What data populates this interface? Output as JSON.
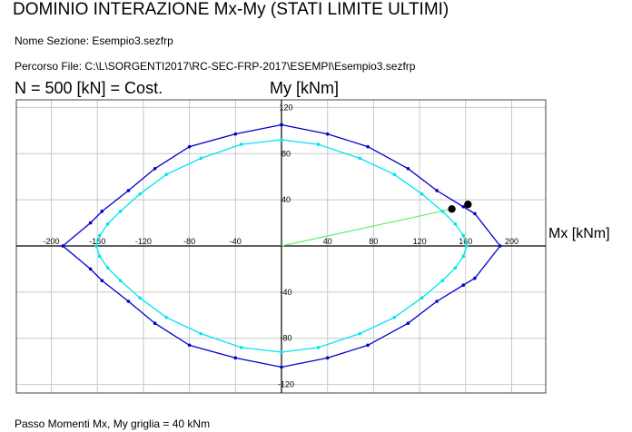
{
  "header": {
    "title": "DOMINIO INTERAZIONE Mx-My (STATI LIMITE ULTIMI)",
    "nome_sezione": "Nome Sezione:  Esempio3.sezfrp",
    "percorso_file": "Percorso File: C:\\L\\SORGENTI2017\\RC-SEC-FRP-2017\\ESEMPI\\Esempio3.sezfrp",
    "n_label": "N = 500 [kN] = Cost."
  },
  "footer": {
    "passo": "Passo Momenti Mx, My  griglia  = 40 kNm"
  },
  "chart_data": {
    "type": "line",
    "xlabel": "Mx [kNm]",
    "ylabel": "My  [kNm]",
    "xlim": [
      -230,
      230
    ],
    "ylim": [
      -127,
      127
    ],
    "grid": true,
    "x_tick_labels": [
      "-200",
      "-160",
      "-120",
      "-80",
      "-40",
      "40",
      "80",
      "120",
      "160",
      "200"
    ],
    "y_tick_labels": [
      "120",
      "80",
      "40",
      "-40",
      "-80",
      "-120"
    ],
    "series": [
      {
        "color": "#0000cc",
        "marker_color": "#0000cc",
        "points": [
          [
            0,
            105
          ],
          [
            40,
            97
          ],
          [
            75,
            86
          ],
          [
            110,
            67
          ],
          [
            135,
            48
          ],
          [
            158,
            34
          ],
          [
            168,
            28
          ],
          [
            190,
            0
          ],
          [
            168,
            -28
          ],
          [
            158,
            -34
          ],
          [
            135,
            -48
          ],
          [
            110,
            -67
          ],
          [
            75,
            -86
          ],
          [
            40,
            -97
          ],
          [
            0,
            -105
          ],
          [
            -40,
            -97
          ],
          [
            -80,
            -86
          ],
          [
            -110,
            -67
          ],
          [
            -133,
            -48
          ],
          [
            -156,
            -30
          ],
          [
            -166,
            -20
          ],
          [
            -190,
            0
          ],
          [
            -166,
            20
          ],
          [
            -156,
            30
          ],
          [
            -133,
            48
          ],
          [
            -110,
            67
          ],
          [
            -80,
            86
          ],
          [
            -40,
            97
          ],
          [
            0,
            105
          ]
        ]
      },
      {
        "color": "#00e5ee",
        "marker_color": "#00e5ee",
        "points": [
          [
            0,
            92
          ],
          [
            32,
            88
          ],
          [
            68,
            76
          ],
          [
            98,
            62
          ],
          [
            122,
            45
          ],
          [
            140,
            30
          ],
          [
            151,
            19
          ],
          [
            158,
            9
          ],
          [
            161,
            0
          ],
          [
            158,
            -9
          ],
          [
            151,
            -19
          ],
          [
            140,
            -30
          ],
          [
            122,
            -45
          ],
          [
            98,
            -62
          ],
          [
            68,
            -76
          ],
          [
            32,
            -88
          ],
          [
            0,
            -92
          ],
          [
            -35,
            -88
          ],
          [
            -70,
            -76
          ],
          [
            -100,
            -62
          ],
          [
            -123,
            -45
          ],
          [
            -140,
            -30
          ],
          [
            -151,
            -19
          ],
          [
            -158,
            -9
          ],
          [
            -161,
            0
          ],
          [
            -158,
            9
          ],
          [
            -151,
            19
          ],
          [
            -140,
            30
          ],
          [
            -123,
            45
          ],
          [
            -100,
            62
          ],
          [
            -70,
            76
          ],
          [
            -35,
            88
          ],
          [
            0,
            92
          ]
        ]
      }
    ],
    "load_line": {
      "color": "#66ee66",
      "from": [
        0,
        0
      ],
      "to": [
        148,
        32
      ]
    },
    "highlight_points": [
      [
        148,
        32
      ],
      [
        162,
        36
      ]
    ]
  }
}
